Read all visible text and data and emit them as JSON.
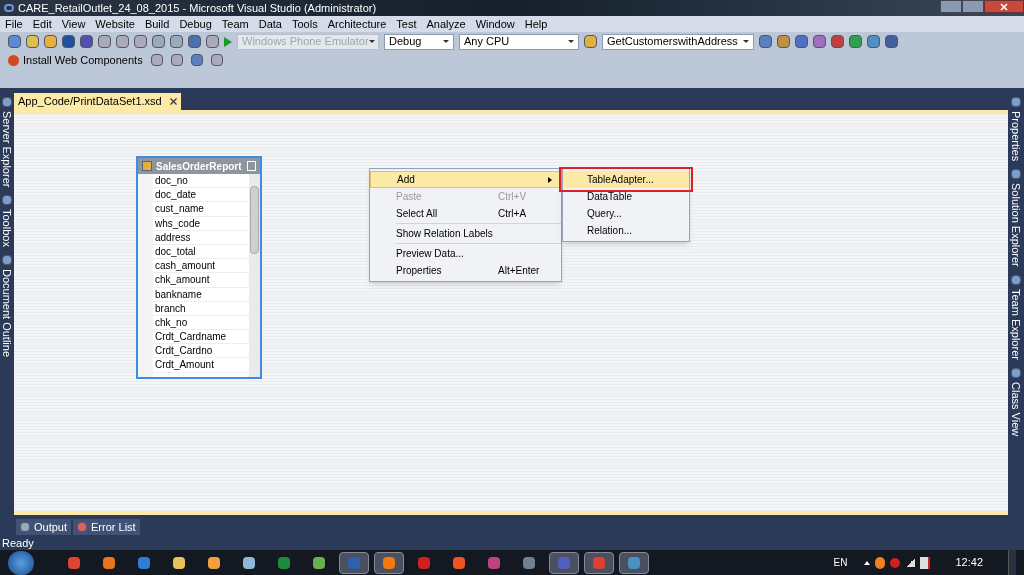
{
  "window": {
    "title": "CARE_RetailOutlet_24_08_2015 - Microsoft Visual Studio (Administrator)"
  },
  "menu": [
    "File",
    "Edit",
    "View",
    "Website",
    "Build",
    "Debug",
    "Team",
    "Data",
    "Tools",
    "Architecture",
    "Test",
    "Analyze",
    "Window",
    "Help"
  ],
  "toolbar": {
    "dropdowns": [
      {
        "value": "Windows Phone Emulator",
        "disabled": true
      },
      {
        "value": "Debug",
        "disabled": false
      },
      {
        "value": "Any CPU",
        "disabled": false
      },
      {
        "value": "GetCustomerswithAddress",
        "disabled": false
      }
    ]
  },
  "toolbar2": {
    "button": "Install Web Components"
  },
  "doc_tabs": [
    {
      "label": "App_Code/PrintDataSet1.xsd",
      "selected": true
    }
  ],
  "left_panel": [
    "Server Explorer",
    "Toolbox",
    "Document Outline"
  ],
  "right_panel": [
    "Properties",
    "Solution Explorer",
    "Team Explorer",
    "Class View"
  ],
  "table": {
    "title": "SalesOrderReport",
    "columns": [
      "doc_no",
      "doc_date",
      "cust_name",
      "whs_code",
      "address",
      "doc_total",
      "cash_amount",
      "chk_amount",
      "bankname",
      "branch",
      "chk_no",
      "Crdt_Cardname",
      "Crdt_Cardno",
      "Crdt_Amount"
    ]
  },
  "context_menu": [
    {
      "kind": "item",
      "label": "Add",
      "highlighted": true,
      "disabled": false,
      "submenu": true
    },
    {
      "kind": "item",
      "label": "Paste",
      "shortcut": "Ctrl+V",
      "highlighted": false,
      "disabled": true,
      "submenu": false
    },
    {
      "kind": "item",
      "label": "Select All",
      "shortcut": "Ctrl+A",
      "highlighted": false,
      "disabled": false,
      "submenu": false
    },
    {
      "kind": "separator"
    },
    {
      "kind": "item",
      "label": "Show Relation Labels",
      "highlighted": false,
      "disabled": false,
      "submenu": false
    },
    {
      "kind": "separator"
    },
    {
      "kind": "item",
      "label": "Preview Data...",
      "highlighted": false,
      "disabled": false,
      "submenu": false
    },
    {
      "kind": "item",
      "label": "Properties",
      "shortcut": "Alt+Enter",
      "highlighted": false,
      "disabled": false,
      "submenu": false
    }
  ],
  "submenu": [
    {
      "label": "TableAdapter...",
      "highlighted": true,
      "marked": true
    },
    {
      "label": "DataTable",
      "highlighted": false,
      "marked": false
    },
    {
      "label": "Query...",
      "highlighted": false,
      "marked": false
    },
    {
      "label": "Relation...",
      "highlighted": false,
      "marked": false
    }
  ],
  "bottom_tabs": [
    "Output",
    "Error List"
  ],
  "status_bar": {
    "text": "Ready"
  },
  "taskbar": {
    "apps": [
      {
        "color": "#dd4433",
        "running": false
      },
      {
        "color": "#e8761c",
        "running": false
      },
      {
        "color": "#2b7fd6",
        "running": false
      },
      {
        "color": "#e5c25a",
        "running": false
      },
      {
        "color": "#f0a040",
        "running": false
      },
      {
        "color": "#8fb8d8",
        "running": false
      },
      {
        "color": "#1e8a3c",
        "running": false
      },
      {
        "color": "#6ab04c",
        "running": false
      },
      {
        "color": "#2f5fb0",
        "running": true
      },
      {
        "color": "#f07a10",
        "running": true
      },
      {
        "color": "#d02020",
        "running": false
      },
      {
        "color": "#ee5522",
        "running": false
      },
      {
        "color": "#c04080",
        "running": false
      },
      {
        "color": "#708090",
        "running": false
      },
      {
        "color": "#5060c0",
        "running": true
      },
      {
        "color": "#e04030",
        "running": true
      },
      {
        "color": "#4a90c0",
        "running": true
      }
    ],
    "language": "EN",
    "clock": "12:42"
  }
}
